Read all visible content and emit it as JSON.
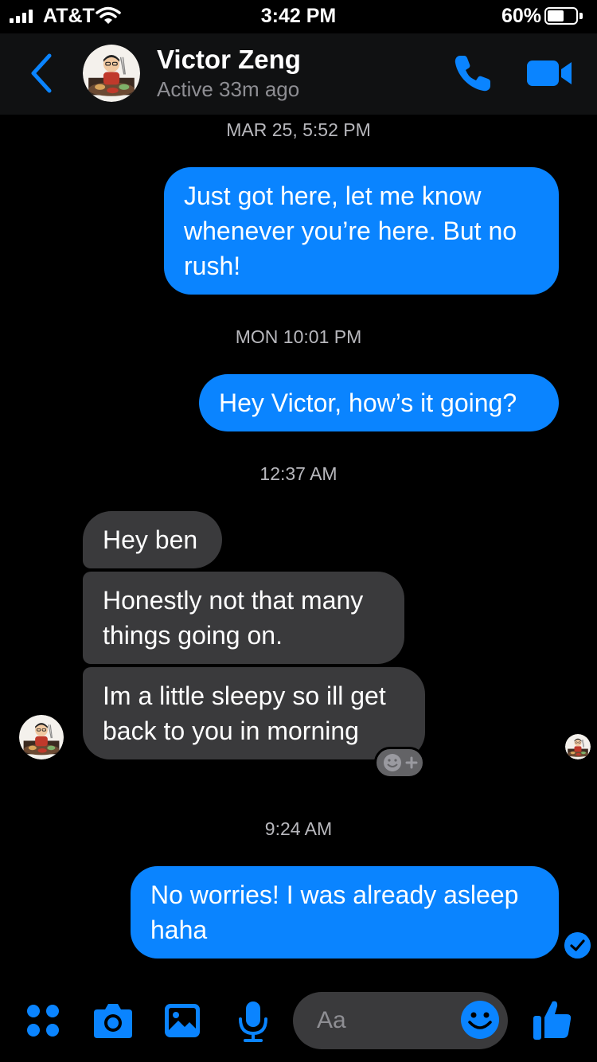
{
  "status_bar": {
    "carrier": "AT&T",
    "time": "3:42 PM",
    "battery": "60%",
    "battery_level": 0.6
  },
  "header": {
    "name": "Victor Zeng",
    "status": "Active 33m ago"
  },
  "timestamps": [
    "MAR 25, 5:52 PM",
    "MON 10:01 PM",
    "12:37 AM",
    "9:24 AM"
  ],
  "messages": [
    {
      "from": "me",
      "lines": [
        "Just got here, let me know",
        "whenever you’re here. But no",
        "rush!"
      ]
    },
    {
      "from": "me",
      "lines": [
        "Hey Victor, how’s it going?"
      ]
    },
    {
      "from": "them",
      "lines": [
        "Hey ben"
      ]
    },
    {
      "from": "them",
      "lines": [
        "Honestly not that many",
        "things going on."
      ]
    },
    {
      "from": "them",
      "lines": [
        "Im a little sleepy so ill get",
        "back to you in morning"
      ]
    },
    {
      "from": "me",
      "lines": [
        "No worries! I was already asleep",
        "haha"
      ]
    }
  ],
  "composer": {
    "placeholder": "Aa"
  },
  "colors": {
    "accent": "#0a84ff",
    "incoming": "#3a3a3c",
    "header": "#101112"
  },
  "icons": [
    "signal-icon",
    "wifi-icon",
    "battery-icon",
    "back-chevron-icon",
    "phone-icon",
    "video-camera-icon",
    "add-reaction-icon",
    "seen-check-icon",
    "apps-grid-icon",
    "camera-icon",
    "photo-icon",
    "microphone-icon",
    "emoji-icon",
    "thumbs-up-icon"
  ]
}
